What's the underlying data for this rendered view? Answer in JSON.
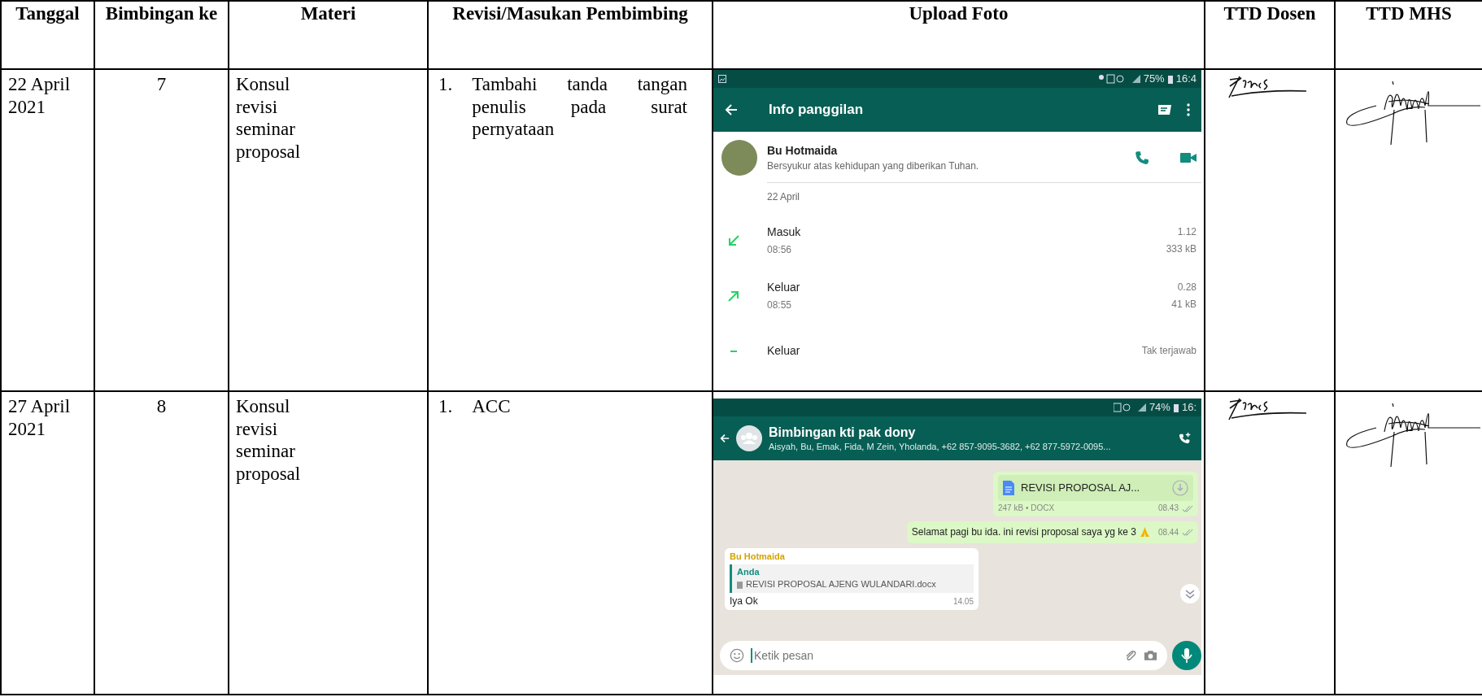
{
  "table": {
    "columns": [
      "Tanggal",
      "Bimbingan ke",
      "Materi",
      "Revisi/Masukan Pembimbing",
      "Upload Foto",
      "TTD Dosen",
      "TTD MHS"
    ],
    "rows": [
      {
        "tanggal": "22 April 2021",
        "bimbingan_ke": "7",
        "materi": "Konsul revisi seminar proposal",
        "revisi": [
          {
            "number": "1.",
            "text": "Tambahi tanda tangan penulis pada surat pernyataan"
          }
        ],
        "upload": {
          "kind": "call_info",
          "status_bar": {
            "battery": "75%",
            "time": "16:4"
          },
          "title": "Info panggilan",
          "contact": {
            "name": "Bu Hotmaida",
            "status": "Bersyukur atas kehidupan yang diberikan Tuhan."
          },
          "date": "22 April",
          "calls": [
            {
              "kind": "incoming",
              "label": "Masuk",
              "time": "08:56",
              "duration": "1.12",
              "size": "333 kB"
            },
            {
              "kind": "outgoing",
              "label": "Keluar",
              "time": "08:55",
              "duration": "0.28",
              "size": "41 kB"
            },
            {
              "kind": "missed",
              "label": "Keluar",
              "status": "Tak terjawab"
            }
          ]
        }
      },
      {
        "tanggal": "27 April 2021",
        "bimbingan_ke": "8",
        "materi": "Konsul revisi seminar proposal",
        "revisi": [
          {
            "number": "1.",
            "text": "ACC"
          }
        ],
        "upload": {
          "kind": "chat",
          "status_bar": {
            "battery": "74%",
            "time": "16:"
          },
          "title": "Bimbingan kti pak dony",
          "subtitle": "Aisyah, Bu, Emak, Fida, M Zein, Yholanda, +62 857-9095-3682, +62 877-5972-0095...",
          "messages": [
            {
              "kind": "document",
              "name": "REVISI PROPOSAL AJ...",
              "meta": "247 kB • DOCX",
              "time": "08.43"
            },
            {
              "kind": "outgoing",
              "text": "Selamat pagi bu ida. ini revisi proposal saya yg ke 3",
              "time": "08.44"
            },
            {
              "kind": "reply",
              "sender": "Bu Hotmaida",
              "quote_author": "Anda",
              "quote_text": "REVISI PROPOSAL AJENG WULANDARI.docx",
              "text": "Iya Ok",
              "time": "14.05"
            }
          ],
          "input_placeholder": "Ketik pesan"
        }
      }
    ]
  }
}
